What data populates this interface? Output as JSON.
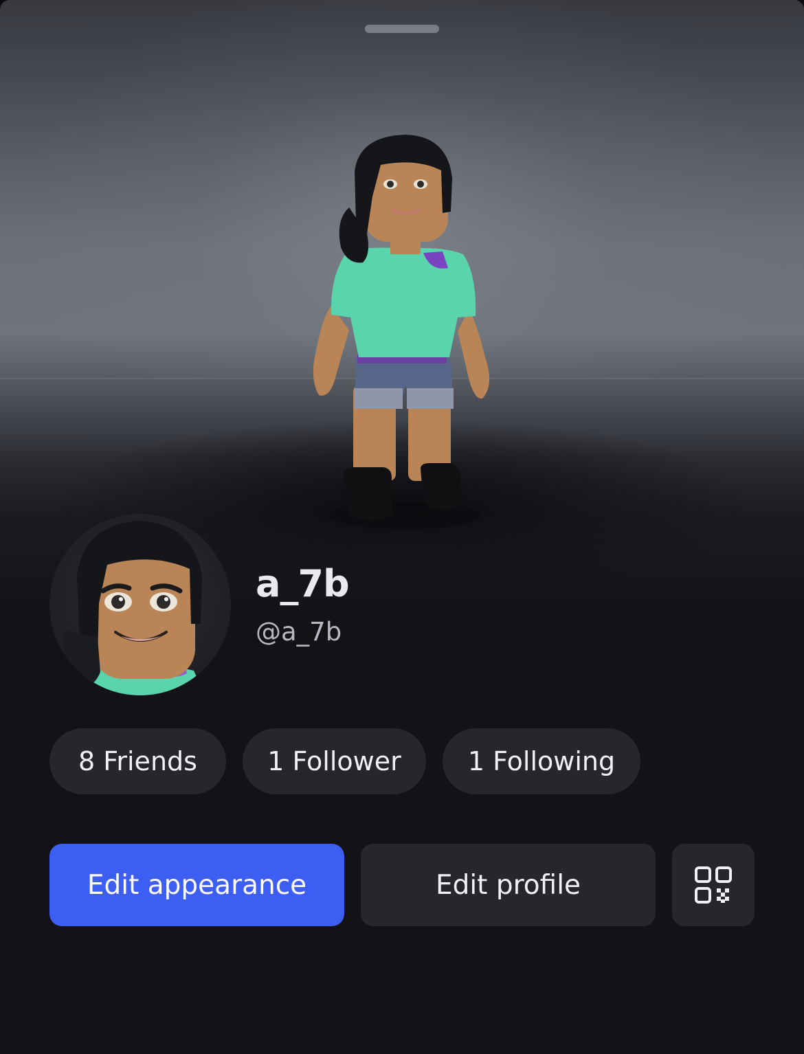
{
  "profile": {
    "display_name": "a_7b",
    "username": "@a_7b"
  },
  "stats": [
    {
      "label": "8 Friends"
    },
    {
      "label": "1 Follower"
    },
    {
      "label": "1 Following"
    }
  ],
  "actions": {
    "edit_appearance_label": "Edit appearance",
    "edit_profile_label": "Edit profile",
    "qr_icon": "qr-code-icon"
  },
  "colors": {
    "primary_button": "#3d5ef2",
    "secondary_surface": "#26272d",
    "background": "#121217"
  }
}
